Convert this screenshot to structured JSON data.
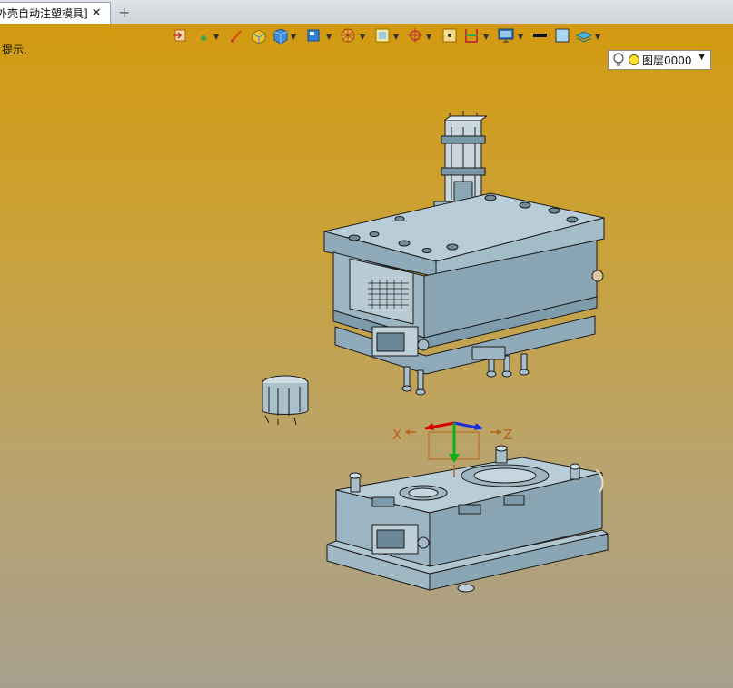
{
  "tab": {
    "title": "外壳自动注塑模具]",
    "close": "✕",
    "new": "+"
  },
  "hint": "提示.",
  "toolbar": {
    "icons": [
      "import-icon",
      "curve-icon",
      "brush-icon",
      "solid-icon",
      "cube-icon",
      "box-view-icon",
      "render-icon",
      "frame-icon",
      "axis-icon",
      "dimension-icon",
      "section-icon",
      "display-icon",
      "line-color-icon",
      "fill-color-icon",
      "layer-stack-icon"
    ],
    "layer_value": "图层0000"
  },
  "triad": {
    "x_label": "X",
    "z_label": "Z"
  }
}
